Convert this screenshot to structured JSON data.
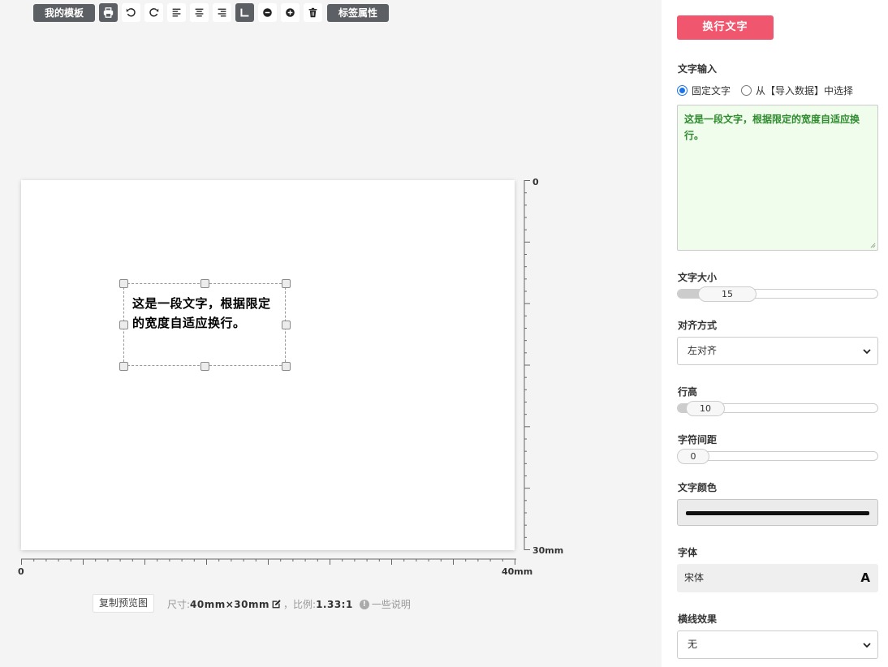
{
  "toolbar": {
    "my_templates_label": "我的模板",
    "label_props_label": "标签属性",
    "icons": [
      "print-icon",
      "undo-icon",
      "redo-icon",
      "align-left-icon",
      "align-center-icon",
      "align-right-icon",
      "corner-icon",
      "zoom-out-icon",
      "zoom-in-icon",
      "trash-icon"
    ]
  },
  "canvas": {
    "text": "这是一段文字，根据限定的宽度自适应换行。"
  },
  "rulers": {
    "v_start": "0",
    "v_end": "30mm",
    "h_start": "0",
    "h_end": "40mm"
  },
  "footer": {
    "copy_preview_label": "复制预览图",
    "size_prefix": "尺寸:",
    "size_value": "40mm×30mm",
    "ratio_prefix": "，比例:",
    "ratio_value": "1.33:1",
    "note_label": "一些说明"
  },
  "panel": {
    "title": "换行文字",
    "text_input": {
      "label": "文字输入",
      "option_fixed": "固定文字",
      "option_import": "从【导入数据】中选择",
      "value": "这是一段文字，根据限定的宽度自适应换行。"
    },
    "font_size": {
      "label": "文字大小",
      "value": "15"
    },
    "align": {
      "label": "对齐方式",
      "value": "左对齐"
    },
    "line_height": {
      "label": "行高",
      "value": "10"
    },
    "letter_spacing": {
      "label": "字符间距",
      "value": "0"
    },
    "color": {
      "label": "文字颜色",
      "value": "#111111"
    },
    "font": {
      "label": "字体",
      "value": "宋体",
      "icon_glyph": "A"
    },
    "underline": {
      "label": "横线效果",
      "value": "无"
    }
  }
}
